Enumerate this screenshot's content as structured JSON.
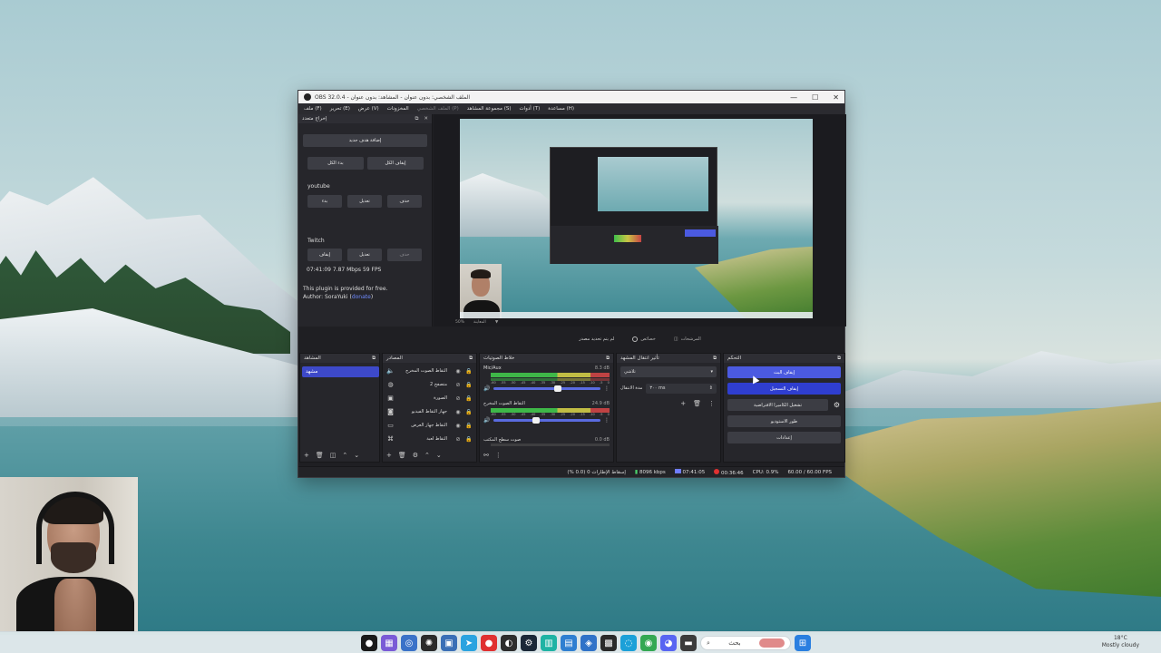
{
  "window": {
    "title": "OBS 32.0.4 - الملف الشخصي: بدون عنوان - المشاهد: بدون عنوان",
    "controls": [
      "—",
      "☐",
      "✕"
    ]
  },
  "menu": {
    "items": [
      "ملف (F)",
      "تحرير (E)",
      "عرض (V)",
      "المخزونات",
      "الملف الشخصي (P)",
      "مجموعة المشاهد (S)",
      "أدوات (T)",
      "مساعدة (H)"
    ]
  },
  "left_dock": {
    "title": "إخراج متعدد",
    "add_target": "إضافة هدف جديد",
    "start_all": "بدء الكل",
    "stop_all": "إيقاف الكل",
    "targets": [
      {
        "name": "youtube",
        "start": "بدء",
        "edit": "تعديل",
        "delete": "حذف"
      },
      {
        "name": "Twitch",
        "start": "إيقاف",
        "edit": "تعديل",
        "delete": "حذف"
      }
    ],
    "stats": "07:41:09  7.87 Mbps  59 FPS",
    "plugin_note": "This plugin is provided for free.",
    "author_prefix": "Author: SoraYuki (",
    "author_link": "donate",
    "author_suffix": ")"
  },
  "preview": {
    "strip": [
      "50%",
      "المعاينة"
    ],
    "scene_bar_left": "لم يتم تحديد مصدر",
    "properties": "خصائص",
    "filters": "المرشحات"
  },
  "scenes": {
    "title": "المشاهد",
    "items": [
      "مشهد"
    ]
  },
  "sources": {
    "title": "المصادر",
    "items": [
      {
        "name": "التقاط الصوت المخرج",
        "icon": "speaker-icon"
      },
      {
        "name": "متصفح 2",
        "icon": "globe-icon"
      },
      {
        "name": "الصورة",
        "icon": "image-icon"
      },
      {
        "name": "جهاز التقاط الفيديو",
        "icon": "camera-icon"
      },
      {
        "name": "التقاط جهاز العرض",
        "icon": "monitor-icon"
      },
      {
        "name": "التقاط لعبة",
        "icon": "gamepad-icon"
      }
    ]
  },
  "mixer": {
    "title": "خلاط الصوتيات",
    "channels": [
      {
        "name": "Mic/Aux",
        "db": "8.3 dB",
        "level": 0.6
      },
      {
        "name": "التقاط الصوت المخرج",
        "db": "24.9 dB",
        "level": 0.4
      },
      {
        "name": "صوت سطح المكتب",
        "db": "0.0 dB",
        "level": 0
      }
    ],
    "ticks": [
      "-60",
      "-55",
      "-50",
      "-45",
      "-40",
      "-35",
      "-30",
      "-25",
      "-20",
      "-15",
      "-10",
      "-5",
      "0"
    ]
  },
  "transitions": {
    "title": "تأثير انتقال المشهد",
    "type": "تلاشي",
    "duration_label": "مدة الانتقال",
    "duration": "٣٠٠ ms"
  },
  "controls": {
    "title": "التحكم",
    "stop_stream": "إيقاف البث",
    "stop_record": "إيقاف التسجيل",
    "virtual_cam": "تشغيل الكاميرا الافتراضية",
    "studio_mode": "طور الاستوديو",
    "settings": "إعدادات"
  },
  "status": {
    "dropped": "إسقاط الإطارات 0 (0.0 %)",
    "bitrate": "8096 kbps",
    "stream_time": "07:41:05",
    "rec_time": "00:36:46",
    "cpu": "CPU: 0.9%",
    "fps": "60.00 / 60.00 FPS"
  },
  "taskbar": {
    "search_text": "بحث",
    "weather_temp": "18°C",
    "weather_desc": "Mostly cloudy"
  },
  "colors": {
    "accent": "#4b5ae0",
    "scene_selected": "#3d49c9",
    "dock_bg": "#26262b"
  }
}
